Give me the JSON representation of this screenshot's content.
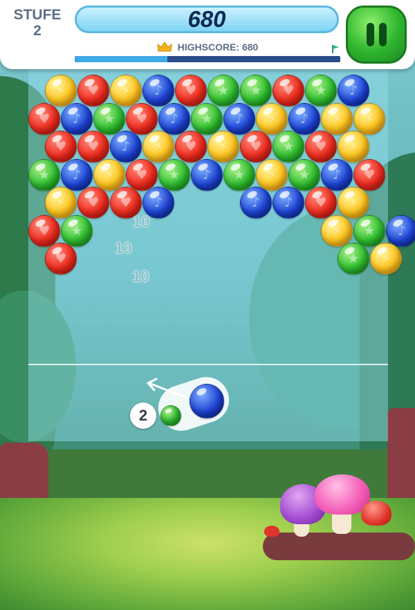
{
  "header": {
    "level_label": "STUFE",
    "level_value": "2",
    "score": "680",
    "highscore": "HIGHSCORE: 680",
    "progress_fraction": 0.35,
    "pause_icon": "pause-icon"
  },
  "points_popups": [
    "10",
    "10",
    "10"
  ],
  "shooter": {
    "remaining_count": "2",
    "current_bubble_color": "blue",
    "next_bubble_color": "green"
  },
  "colors": {
    "red": "#ee2c1e",
    "yellow": "#ffc61f",
    "green": "#2fbf2f",
    "blue": "#1e44d6",
    "pause_button": "#2fb52f",
    "score_text": "#0e2a52"
  },
  "bubble_rows": [
    [
      "yellow",
      "red",
      "yellow",
      "blue",
      "red",
      "green",
      "green",
      "red",
      "green",
      "blue"
    ],
    [
      "red",
      "blue",
      "green",
      "red",
      "blue",
      "green",
      "blue",
      "yellow",
      "blue",
      "yellow",
      "yellow"
    ],
    [
      "red",
      "red",
      "blue",
      "yellow",
      "red",
      "yellow",
      "red",
      "green",
      "red",
      "yellow"
    ],
    [
      "green",
      "blue",
      "yellow",
      "red",
      "green",
      "blue",
      "green",
      "yellow",
      "green",
      "blue",
      "red"
    ],
    [
      "yellow",
      "red",
      "red",
      "blue",
      null,
      null,
      "blue",
      "blue",
      "red",
      "yellow"
    ],
    [
      "red",
      "green",
      null,
      null,
      null,
      null,
      null,
      null,
      null,
      "yellow",
      "green",
      "blue"
    ],
    [
      "red",
      null,
      null,
      null,
      null,
      null,
      null,
      null,
      null,
      "green",
      "yellow"
    ]
  ]
}
